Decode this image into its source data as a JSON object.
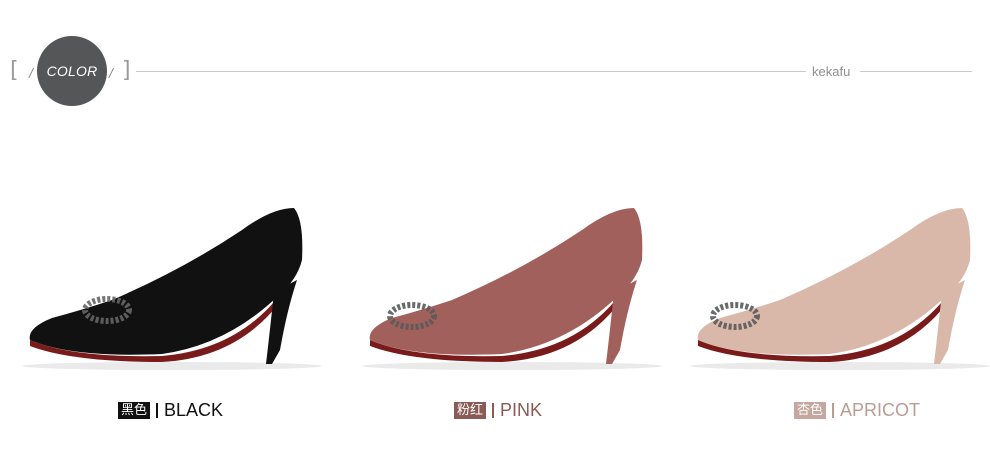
{
  "header": {
    "badge_label": "COLOR",
    "brand": "kekafu",
    "left_bracket": "[",
    "right_bracket": "]",
    "slash": "/"
  },
  "products": [
    {
      "cn": "黑色",
      "en": "BLACK",
      "color": "#111111",
      "sole": "#7a1b1b"
    },
    {
      "cn": "粉红",
      "en": "PINK",
      "color": "#a2605c",
      "sole": "#7a1b1b"
    },
    {
      "cn": "杏色",
      "en": "APRICOT",
      "color": "#d9b8aa",
      "sole": "#7a1b1b"
    }
  ],
  "colors": {
    "badge": "#555657",
    "rule": "#c9c9c9",
    "brand_text": "#8f8f8f"
  }
}
